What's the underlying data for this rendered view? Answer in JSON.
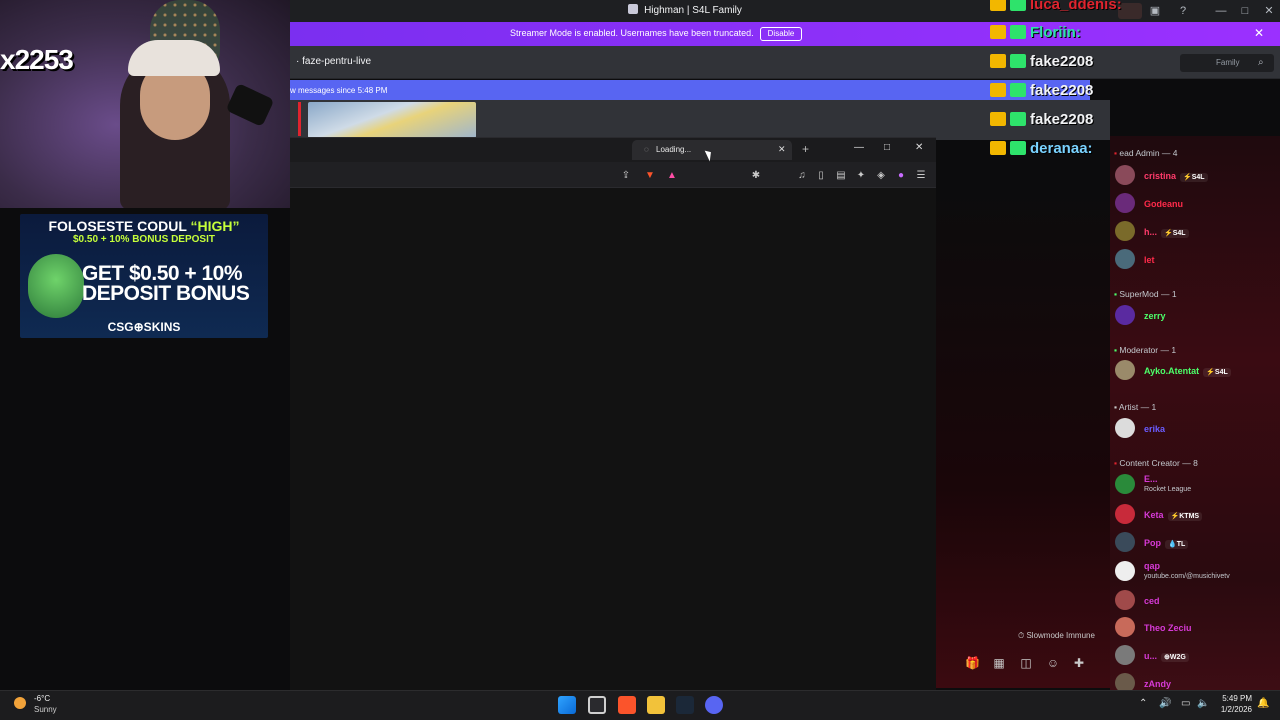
{
  "window": {
    "title": "Highman | S4L Family"
  },
  "banner": {
    "text": "Streamer Mode is enabled. Usernames have been truncated.",
    "disable_label": "Disable"
  },
  "channel": {
    "name": "faze-pentru-live",
    "search_placeholder": "Family"
  },
  "new_messages": {
    "text": "w messages since 5:48 PM"
  },
  "browser": {
    "tab_label": "Loading..."
  },
  "webcam": {
    "overlay_count": "x2253"
  },
  "ad": {
    "line1_prefix": "FOLOSESTE CODUL ",
    "line1_code": "“HIGH”",
    "line2": "$0.50 + 10% BONUS DEPOSIT",
    "big1": "GET $0.50 + 10%",
    "big2": "DEPOSIT BONUS",
    "brand": "CSG⊕SKINS"
  },
  "overlay_chat": [
    {
      "name": "luca_ddenis:",
      "color": "#e0242e"
    },
    {
      "name": "Floriin:",
      "color": "#2ee3a8"
    },
    {
      "name": "fake2208",
      "color": "#f2f3f5"
    },
    {
      "name": "fake2208",
      "color": "#f2f3f5"
    },
    {
      "name": "fake2208",
      "color": "#f2f3f5"
    },
    {
      "name": "deranaa:",
      "color": "#7ad3ff"
    }
  ],
  "members": {
    "groups": [
      {
        "label": "ead Admin — 4"
      },
      {
        "label": "SuperMod — 1"
      },
      {
        "label": "Moderator — 1"
      },
      {
        "label": "Artist — 1"
      },
      {
        "label": "Content Creator — 8"
      }
    ],
    "users": [
      {
        "name": "cristina",
        "color": "#ff3b6b",
        "tag": "⚡S4L"
      },
      {
        "name": "Godeanu",
        "color": "#ff2a4a",
        "tag": ""
      },
      {
        "name": "h...",
        "color": "#ff3b6b",
        "tag": "⚡S4L"
      },
      {
        "name": "let",
        "color": "#ff2a4a",
        "tag": ""
      },
      {
        "name": "zerry",
        "color": "#4cff6a",
        "tag": ""
      },
      {
        "name": "Ayko.Atentat",
        "color": "#4cff6a",
        "tag": "⚡S4L"
      },
      {
        "name": "erika",
        "color": "#6a5cff",
        "tag": ""
      },
      {
        "name": "E...",
        "color": "#d63ad6",
        "tag": "",
        "sub": "Rocket League"
      },
      {
        "name": "Keta",
        "color": "#d63ad6",
        "tag": "⚡KTMS"
      },
      {
        "name": "Pop",
        "color": "#d63ad6",
        "tag": "💧TL"
      },
      {
        "name": "qap",
        "color": "#d63ad6",
        "tag": "",
        "sub": "youtube.com/@musichivetv"
      },
      {
        "name": "ced",
        "color": "#d63ad6",
        "tag": ""
      },
      {
        "name": "Theo Zeciu",
        "color": "#d63ad6",
        "tag": ""
      },
      {
        "name": "u...",
        "color": "#d63ad6",
        "tag": "⊕W2G"
      },
      {
        "name": "zAndy",
        "color": "#d63ad6",
        "tag": ""
      }
    ]
  },
  "chat": {
    "slowmode": "Slowmode Immune"
  },
  "taskbar": {
    "weather_temp": "-6°C",
    "weather_desc": "Sunny",
    "time": "5:49 PM",
    "date": "1/2/2026"
  }
}
